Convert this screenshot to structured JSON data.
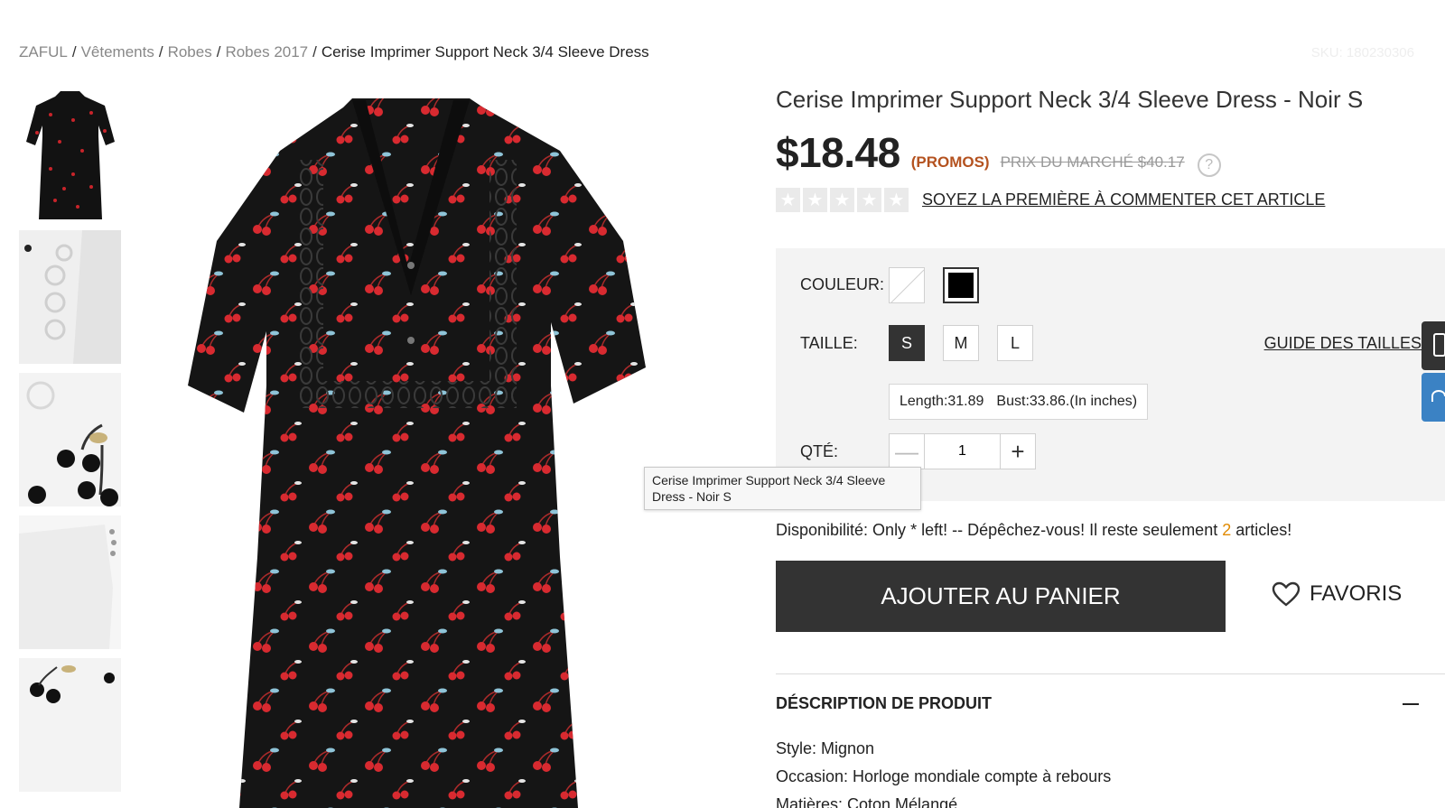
{
  "breadcrumb": {
    "items": [
      "ZAFUL",
      "Vêtements",
      "Robes",
      "Robes 2017"
    ],
    "current": "Cerise Imprimer Support Neck 3/4 Sleeve Dress",
    "sku": "SKU: 180230306"
  },
  "product": {
    "title": "Cerise Imprimer Support Neck 3/4 Sleeve Dress - Noir S",
    "price": "$18.48",
    "promo": "(PROMOS)",
    "market_price": "PRIX DU MARCHÉ $40.17",
    "help_icon": "?",
    "review_link": "SOYEZ LA PREMIÈRE À COMMENTER CET ARTICLE",
    "rating_stars": 0
  },
  "tooltip": "Cerise Imprimer Support Neck 3/4 Sleeve Dress - Noir S",
  "options": {
    "color_label": "COULEUR:",
    "size_label": "TAILLE:",
    "sizes": [
      "S",
      "M",
      "L"
    ],
    "selected_size": "S",
    "size_guide": "GUIDE DES TAILLES",
    "length": "Length:31.89",
    "bust": "Bust:33.86.(In inches)",
    "qty_label": "QTÉ:",
    "qty_value": "1",
    "minus": "—",
    "plus": "+"
  },
  "availability": {
    "before": "Disponibilité: Only * left! -- Dépêchez-vous! Il reste seulement ",
    "count": "2",
    "after": " articles!"
  },
  "actions": {
    "add_to_cart": "AJOUTER AU PANIER",
    "favorites": "FAVORIS"
  },
  "description": {
    "title": "DÉSCRIPTION DE PRODUIT",
    "lines": [
      "Style: Mignon",
      "Occasion: Horloge mondiale compte à rebours",
      "Matières: Coton Mélangé"
    ]
  },
  "colors": {
    "accent_dark": "#333333",
    "promo": "#b4521f",
    "count": "#e08a00",
    "side_tab_blue": "#3b82c4"
  }
}
